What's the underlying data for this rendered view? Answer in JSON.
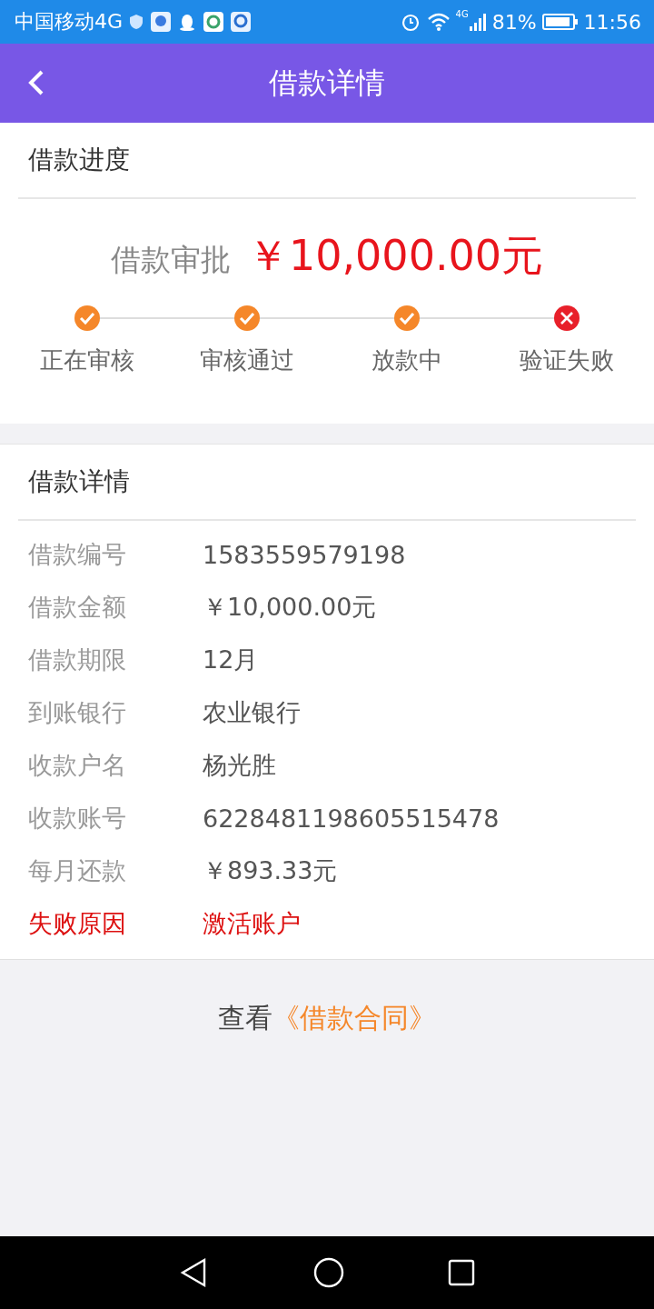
{
  "status_bar": {
    "carrier": "中国移动4G",
    "network": "4G",
    "battery": "81%",
    "time": "11:56"
  },
  "header": {
    "title": "借款详情"
  },
  "progress": {
    "title": "借款进度",
    "label": "借款审批",
    "amount": "￥10,000.00元",
    "steps": [
      {
        "label": "正在审核",
        "failed": false
      },
      {
        "label": "审核通过",
        "failed": false
      },
      {
        "label": "放款中",
        "failed": false
      },
      {
        "label": "验证失败",
        "failed": true
      }
    ]
  },
  "details": {
    "title": "借款详情",
    "rows": [
      {
        "label": "借款编号",
        "value": "1583559579198",
        "kind": "normal"
      },
      {
        "label": "借款金额",
        "value": "￥10,000.00元",
        "kind": "normal"
      },
      {
        "label": "借款期限",
        "value": "12月",
        "kind": "normal"
      },
      {
        "label": "到账银行",
        "value": "农业银行",
        "kind": "normal"
      },
      {
        "label": "收款户名",
        "value": "杨光胜",
        "kind": "normal"
      },
      {
        "label": "收款账号",
        "value": "6228481198605515478",
        "kind": "normal"
      },
      {
        "label": "每月还款",
        "value": "￥893.33元",
        "kind": "normal"
      },
      {
        "label": "失败原因",
        "value": "激活账户",
        "kind": "alert"
      }
    ]
  },
  "contract": {
    "prefix": "查看",
    "link": "《借款合同》"
  }
}
